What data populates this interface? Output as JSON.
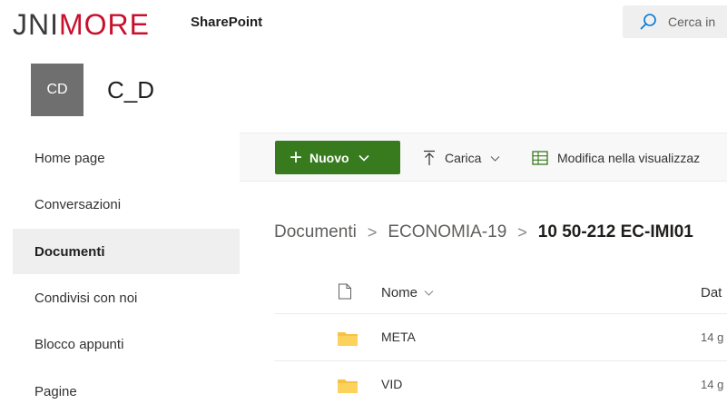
{
  "suitebar": {
    "logo_part1": "JNI",
    "logo_part2": "MORE",
    "app_name": "SharePoint",
    "search_placeholder": "Cerca in"
  },
  "site": {
    "logo_initials": "CD",
    "title": "C_D"
  },
  "leftnav": {
    "items": [
      {
        "label": "Home page",
        "active": false
      },
      {
        "label": "Conversazioni",
        "active": false
      },
      {
        "label": "Documenti",
        "active": true
      },
      {
        "label": "Condivisi con noi",
        "active": false
      },
      {
        "label": "Blocco appunti",
        "active": false
      },
      {
        "label": "Pagine",
        "active": false
      }
    ]
  },
  "commandbar": {
    "new_label": "Nuovo",
    "upload_label": "Carica",
    "edit_grid_label": "Modifica nella visualizzaz"
  },
  "breadcrumb": {
    "items": [
      "Documenti",
      "ECONOMIA-19"
    ],
    "current": "10 50-212 EC-IMI01"
  },
  "filelist": {
    "col_name": "Nome",
    "col_date": "Dat",
    "rows": [
      {
        "name": "META",
        "date": "14 g"
      },
      {
        "name": "VID",
        "date": "14 g"
      }
    ]
  },
  "colors": {
    "accent_green": "#377b1e",
    "logo_red": "#c8102e",
    "folder_yellow": "#f5c342"
  }
}
